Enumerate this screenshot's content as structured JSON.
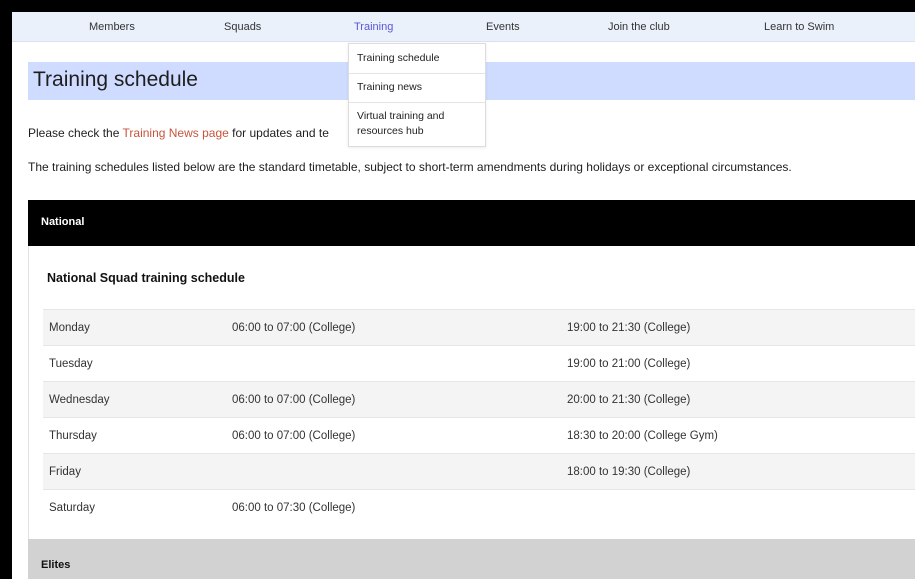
{
  "nav": {
    "items": [
      "Members",
      "Squads",
      "Training",
      "Events",
      "Join the club",
      "Learn to Swim"
    ],
    "active": "Training",
    "active_color": "#5a55d9"
  },
  "dropdown": {
    "items": [
      "Training schedule",
      "Training news",
      "Virtual training and resources hub"
    ]
  },
  "page": {
    "title": "Training schedule",
    "intro_prefix": "Please check the ",
    "intro_link": "Training News page",
    "intro_suffix": " for updates and te",
    "intro2": "The training schedules listed below are the standard timetable, subject to short-term amendments during holidays or exceptional circumstances."
  },
  "national": {
    "header": "National",
    "schedule_title": "National Squad training schedule",
    "rows": [
      {
        "day": "Monday",
        "am": "06:00 to 07:00 (College)",
        "pm": "19:00 to 21:30 (College)"
      },
      {
        "day": "Tuesday",
        "am": "",
        "pm": "19:00 to 21:00 (College)"
      },
      {
        "day": "Wednesday",
        "am": "06:00 to 07:00 (College)",
        "pm": "20:00 to 21:30 (College)"
      },
      {
        "day": "Thursday",
        "am": "06:00 to 07:00 (College)",
        "pm": "18:30 to 20:00 (College Gym)"
      },
      {
        "day": "Friday",
        "am": "",
        "pm": "18:00 to 19:30 (College)"
      },
      {
        "day": "Saturday",
        "am": "06:00 to 07:30 (College)",
        "pm": ""
      }
    ]
  },
  "elites": {
    "header": "Elites"
  },
  "colors": {
    "link": "#c8543c",
    "title_band": "#cfdcff",
    "nav_bg": "#eaf1fb"
  }
}
